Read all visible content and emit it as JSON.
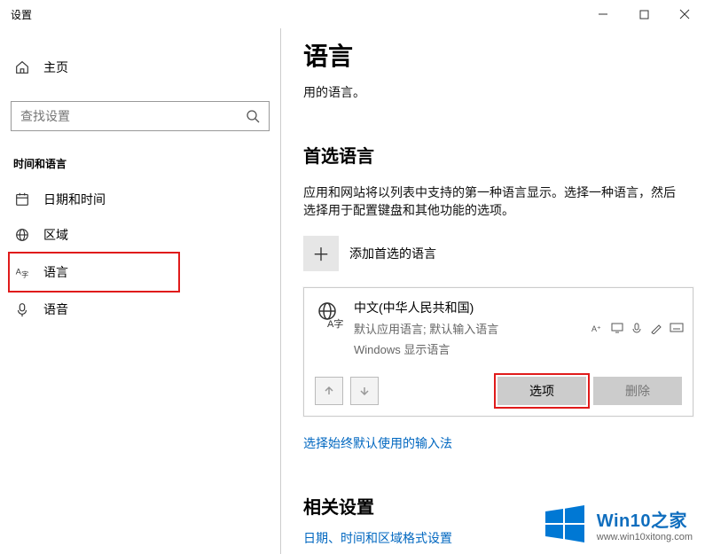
{
  "window": {
    "title": "设置"
  },
  "sidebar": {
    "home": "主页",
    "search_placeholder": "查找设置",
    "category": "时间和语言",
    "items": [
      {
        "label": "日期和时间"
      },
      {
        "label": "区域"
      },
      {
        "label": "语言"
      },
      {
        "label": "语音"
      }
    ]
  },
  "main": {
    "heading": "语言",
    "desc": "用的语言。",
    "pref_heading": "首选语言",
    "pref_desc": "应用和网站将以列表中支持的第一种语言显示。选择一种语言，然后选择用于配置键盘和其他功能的选项。",
    "add_label": "添加首选的语言",
    "language": {
      "name": "中文(中华人民共和国)",
      "sub1": "默认应用语言; 默认输入语言",
      "sub2": "Windows 显示语言"
    },
    "options_btn": "选项",
    "delete_btn": "删除",
    "ime_link": "选择始终默认使用的输入法",
    "related_heading": "相关设置",
    "related_link": "日期、时间和区域格式设置"
  },
  "watermark": {
    "brand": "Win10之家",
    "url": "www.win10xitong.com"
  }
}
